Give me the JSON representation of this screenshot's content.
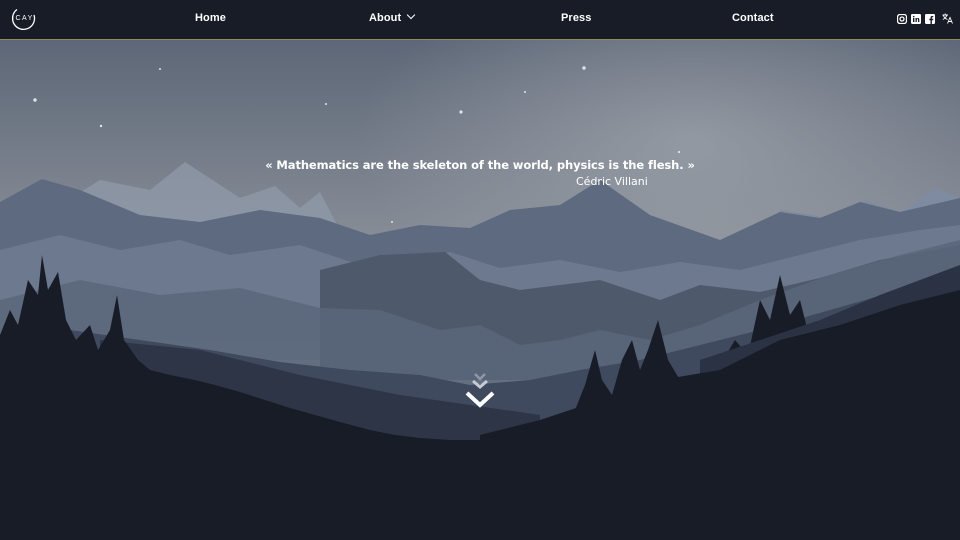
{
  "brand": {
    "logo_text": "ICAY"
  },
  "nav": {
    "home": "Home",
    "about": "About",
    "press": "Press",
    "contact": "Contact"
  },
  "social": {
    "icons": [
      "instagram-icon",
      "linkedin-icon",
      "facebook-icon",
      "translate-icon"
    ]
  },
  "hero": {
    "quote": "« Mathematics are the skeleton of the world, physics is the flesh. »",
    "author": "Cédric Villani"
  },
  "colors": {
    "nav_bg": "#181c27",
    "nav_border": "#8e8a5a",
    "sky_top": "#5d6777",
    "sky_bottom": "#a9acb0",
    "forest": "#181c27"
  }
}
